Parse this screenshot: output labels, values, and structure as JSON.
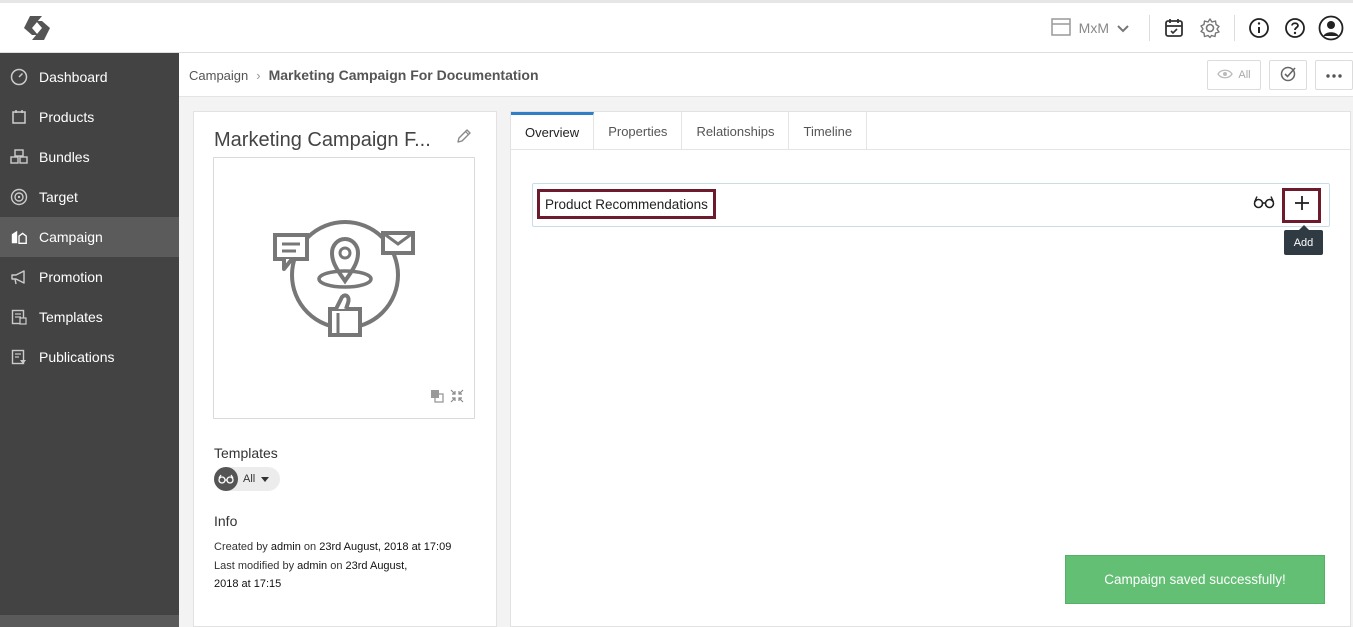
{
  "topbar": {
    "logo": "app-logo",
    "context_label": "MxM",
    "icons": [
      "archive-icon",
      "chevron-down-icon",
      "calendar-icon",
      "gear-icon",
      "info-icon",
      "help-icon",
      "user-icon"
    ]
  },
  "sidebar": {
    "items": [
      {
        "label": "Dashboard",
        "icon": "dashboard-icon"
      },
      {
        "label": "Products",
        "icon": "products-icon"
      },
      {
        "label": "Bundles",
        "icon": "bundles-icon"
      },
      {
        "label": "Target",
        "icon": "target-icon"
      },
      {
        "label": "Campaign",
        "icon": "campaign-icon",
        "active": true
      },
      {
        "label": "Promotion",
        "icon": "megaphone-icon"
      },
      {
        "label": "Templates",
        "icon": "templates-icon"
      },
      {
        "label": "Publications",
        "icon": "publications-icon"
      }
    ]
  },
  "breadcrumb": {
    "parent": "Campaign",
    "separator": "›",
    "current": "Marketing Campaign For Documentation"
  },
  "toolbar": {
    "view_label": "All"
  },
  "entity": {
    "title": "Marketing Campaign F...",
    "templates_heading": "Templates",
    "templates_filter": "All",
    "info_heading": "Info",
    "created_prefix": "Created by",
    "created_user": "admin",
    "created_on_word": "on",
    "created_date": "23rd August, 2018 at 17:09",
    "modified_prefix": "Last modified by",
    "modified_user": "admin",
    "modified_on_word": "on",
    "modified_date_1": "23rd August,",
    "modified_date_2": "2018 at 17:15"
  },
  "tabs": [
    {
      "label": "Overview",
      "active": true
    },
    {
      "label": "Properties"
    },
    {
      "label": "Relationships"
    },
    {
      "label": "Timeline"
    }
  ],
  "overview": {
    "card_title": "Product Recommendations",
    "add_tooltip": "Add"
  },
  "toast": {
    "message": "Campaign saved successfully!"
  },
  "colors": {
    "sidebar_bg": "#434343",
    "sidebar_active": "#5b5b5b",
    "highlight_border": "#6d1a2c",
    "tab_accent": "#2e7ec8",
    "toast_bg": "#62bf74"
  }
}
